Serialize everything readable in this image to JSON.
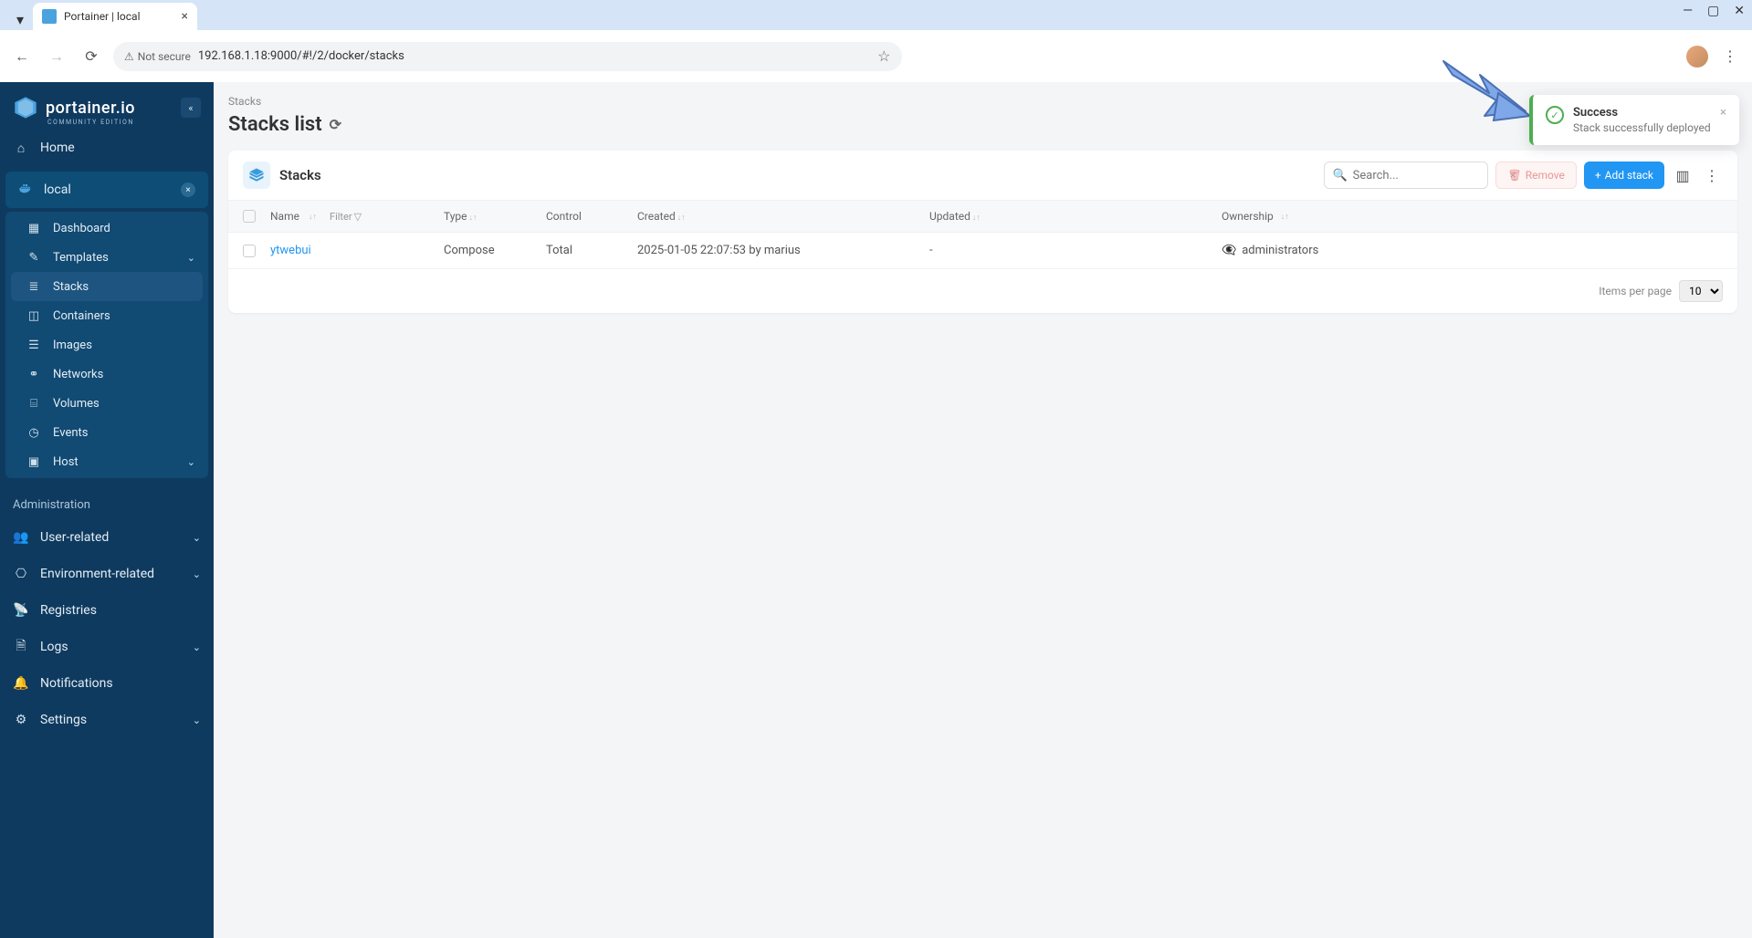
{
  "browser": {
    "tab_title": "Portainer | local",
    "not_secure": "Not secure",
    "url": "192.168.1.18:9000/#!/2/docker/stacks"
  },
  "sidebar": {
    "brand": "portainer.io",
    "brand_sub": "COMMUNITY EDITION",
    "home": "Home",
    "env": "local",
    "items": {
      "dashboard": "Dashboard",
      "templates": "Templates",
      "stacks": "Stacks",
      "containers": "Containers",
      "images": "Images",
      "networks": "Networks",
      "volumes": "Volumes",
      "events": "Events",
      "host": "Host"
    },
    "admin_header": "Administration",
    "admin": {
      "user_related": "User-related",
      "env_related": "Environment-related",
      "registries": "Registries",
      "logs": "Logs",
      "notifications": "Notifications",
      "settings": "Settings"
    }
  },
  "page": {
    "breadcrumb": "Stacks",
    "title": "Stacks list"
  },
  "panel": {
    "title": "Stacks",
    "search_placeholder": "Search...",
    "remove_label": "Remove",
    "add_label": "Add stack"
  },
  "table": {
    "headers": {
      "name": "Name",
      "filter": "Filter",
      "type": "Type",
      "control": "Control",
      "created": "Created",
      "updated": "Updated",
      "ownership": "Ownership"
    },
    "rows": [
      {
        "name": "ytwebui",
        "type": "Compose",
        "control": "Total",
        "created": "2025-01-05 22:07:53 by marius",
        "updated": "-",
        "ownership": "administrators"
      }
    ],
    "items_per_page_label": "Items per page",
    "items_per_page_value": "10"
  },
  "toast": {
    "title": "Success",
    "message": "Stack successfully deployed"
  }
}
